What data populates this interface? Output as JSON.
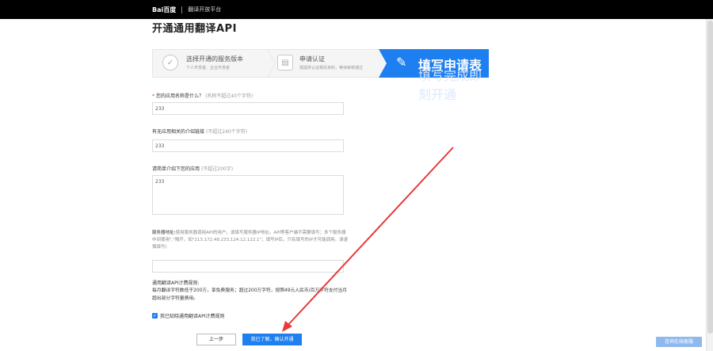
{
  "header": {
    "brand": "Bai百度",
    "platform": "翻译开放平台"
  },
  "page": {
    "title": "开通通用翻译API"
  },
  "steps": [
    {
      "title": "选择开通的服务版本",
      "sub": "个人开发者、企业开发者",
      "icon": "check-icon"
    },
    {
      "title": "申请认证",
      "sub": "需提供认证相关资料，等待审核通过",
      "icon": "id-card-icon"
    },
    {
      "title": "填写申请表格",
      "sub": "填写完成即刻开通",
      "icon": "edit-icon",
      "active": true
    }
  ],
  "form": {
    "app_name": {
      "required": "*",
      "label": "您的应用名称是什么？",
      "hint": "(名称不超过40个字符)",
      "value": "233"
    },
    "app_link": {
      "label": "有无应用相关的介绍链接",
      "hint": "(不超过240个字符)",
      "value": "233"
    },
    "app_intro": {
      "label": "请简单介绍下您的应用",
      "hint": "(不超过200字)",
      "value": "233"
    },
    "server_addr": {
      "label": "服务器地址",
      "note": "(使用服务器调用API的用户，请填写服务器IP地址。API等客户端不需要填写；多个服务器中间使用\",\"隔开，如\"113.172.48.233,124.12.122.1\"；填写IP后，只有填写的IP才可能调用。请谨慎填写)",
      "value": ""
    },
    "rules_title": "通用翻译API计费规则:",
    "rules_text": "每月翻译字符数低于200万，享免费服务；超过200万字符，按照49元人民币/百万字符支付当月超出部分字符量费用。",
    "agree_label": "我已知晓通用翻译API计费规则",
    "agree_checked": true,
    "prev_label": "上一步",
    "confirm_label": "我已了解，确认开通"
  },
  "float": {
    "consult_label": "咨询在线客服"
  },
  "colors": {
    "accent": "#1e7ff0",
    "annotation_arrow": "#e83a3a",
    "topbar": "#000000"
  }
}
